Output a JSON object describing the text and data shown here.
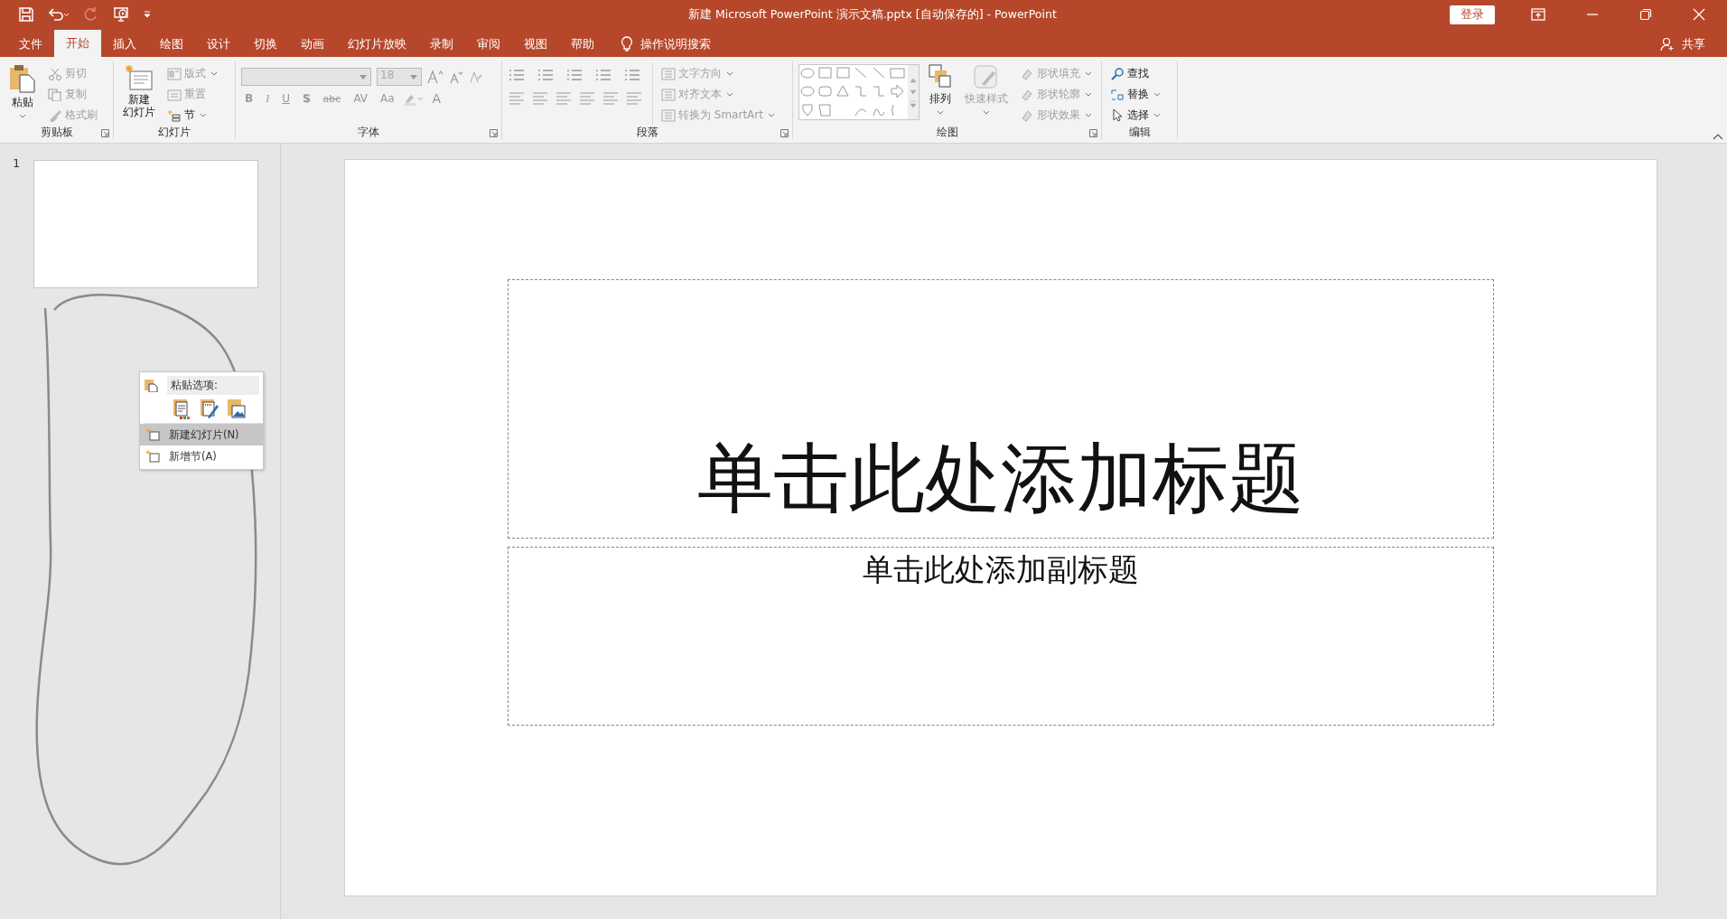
{
  "window": {
    "title": "新建 Microsoft PowerPoint 演示文稿.pptx [自动保存的]  -  PowerPoint",
    "sign_in": "登录"
  },
  "tabs": [
    {
      "label": "文件",
      "selected": false
    },
    {
      "label": "开始",
      "selected": true
    },
    {
      "label": "插入",
      "selected": false
    },
    {
      "label": "绘图",
      "selected": false
    },
    {
      "label": "设计",
      "selected": false
    },
    {
      "label": "切换",
      "selected": false
    },
    {
      "label": "动画",
      "selected": false
    },
    {
      "label": "幻灯片放映",
      "selected": false
    },
    {
      "label": "录制",
      "selected": false
    },
    {
      "label": "审阅",
      "selected": false
    },
    {
      "label": "视图",
      "selected": false
    },
    {
      "label": "帮助",
      "selected": false
    }
  ],
  "tell_me": "操作说明搜索",
  "share": "共享",
  "clipboard": {
    "label": "剪贴板",
    "paste": "粘贴",
    "items": [
      {
        "label": "剪切",
        "disabled": true
      },
      {
        "label": "复制",
        "disabled": true
      },
      {
        "label": "格式刷",
        "disabled": true
      }
    ]
  },
  "slides": {
    "label": "幻灯片",
    "new_slide": [
      "新建",
      "幻灯片"
    ],
    "items": [
      {
        "label": "版式",
        "disabled": true
      },
      {
        "label": "重置",
        "disabled": true
      },
      {
        "label": "节",
        "disabled": false
      }
    ]
  },
  "font": {
    "label": "字体",
    "size": "18",
    "buttons": [
      {
        "label": "B",
        "kind": "bold"
      },
      {
        "label": "I",
        "kind": "italic"
      },
      {
        "label": "U",
        "kind": "underline"
      },
      {
        "label": "S",
        "kind": "shadow"
      },
      {
        "label": "abc",
        "kind": "strike"
      },
      {
        "label": "AV",
        "kind": "spacing"
      },
      {
        "label": "Aa",
        "kind": "case"
      }
    ],
    "color_label": "A"
  },
  "paragraph": {
    "label": "段落",
    "items": [
      {
        "label": "文字方向",
        "disabled": true
      },
      {
        "label": "对齐文本",
        "disabled": true
      },
      {
        "label": "转换为 SmartArt",
        "disabled": true
      }
    ]
  },
  "drawing": {
    "label": "绘图",
    "arrange": "排列",
    "quick_styles": "快速样式",
    "items": [
      {
        "label": "形状填充",
        "disabled": true
      },
      {
        "label": "形状轮廓",
        "disabled": true
      },
      {
        "label": "形状效果",
        "disabled": true
      }
    ]
  },
  "editing": {
    "label": "编辑",
    "items": [
      {
        "label": "查找",
        "disabled": false
      },
      {
        "label": "替换",
        "disabled": false
      },
      {
        "label": "选择",
        "disabled": false
      }
    ]
  },
  "thumbnail": {
    "number": "1"
  },
  "slide": {
    "title_placeholder": "单击此处添加标题",
    "subtitle_placeholder": "单击此处添加副标题"
  },
  "context_menu": {
    "header": "粘贴选项:",
    "items": [
      {
        "label": "新建幻灯片(N)",
        "selected": true
      },
      {
        "label": "新增节(A)",
        "selected": false
      }
    ]
  }
}
